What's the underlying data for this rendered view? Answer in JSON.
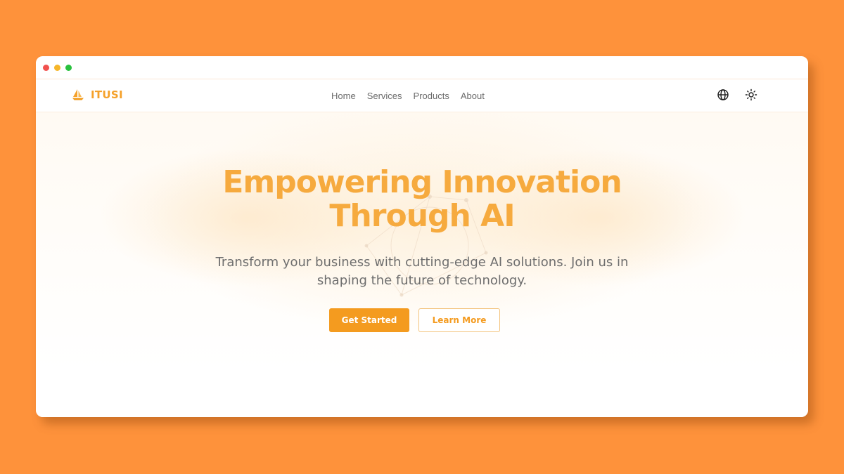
{
  "brand": {
    "name": "ITUSI",
    "icon": "sailboat-icon",
    "color": "#f5a12a"
  },
  "nav": {
    "links": [
      "Home",
      "Services",
      "Products",
      "About"
    ],
    "icons": [
      "globe-icon",
      "sun-icon"
    ]
  },
  "hero": {
    "title_line1": "Empowering Innovation",
    "title_line2": "Through AI",
    "subtitle_line1": "Transform your business with cutting-edge AI solutions. Join us in",
    "subtitle_line2": "shaping the future of technology.",
    "primary_button": "Get Started",
    "secondary_button": "Learn More"
  },
  "colors": {
    "accent": "#f49b1f",
    "title": "#f6aa3e",
    "background": "#fe923b"
  }
}
